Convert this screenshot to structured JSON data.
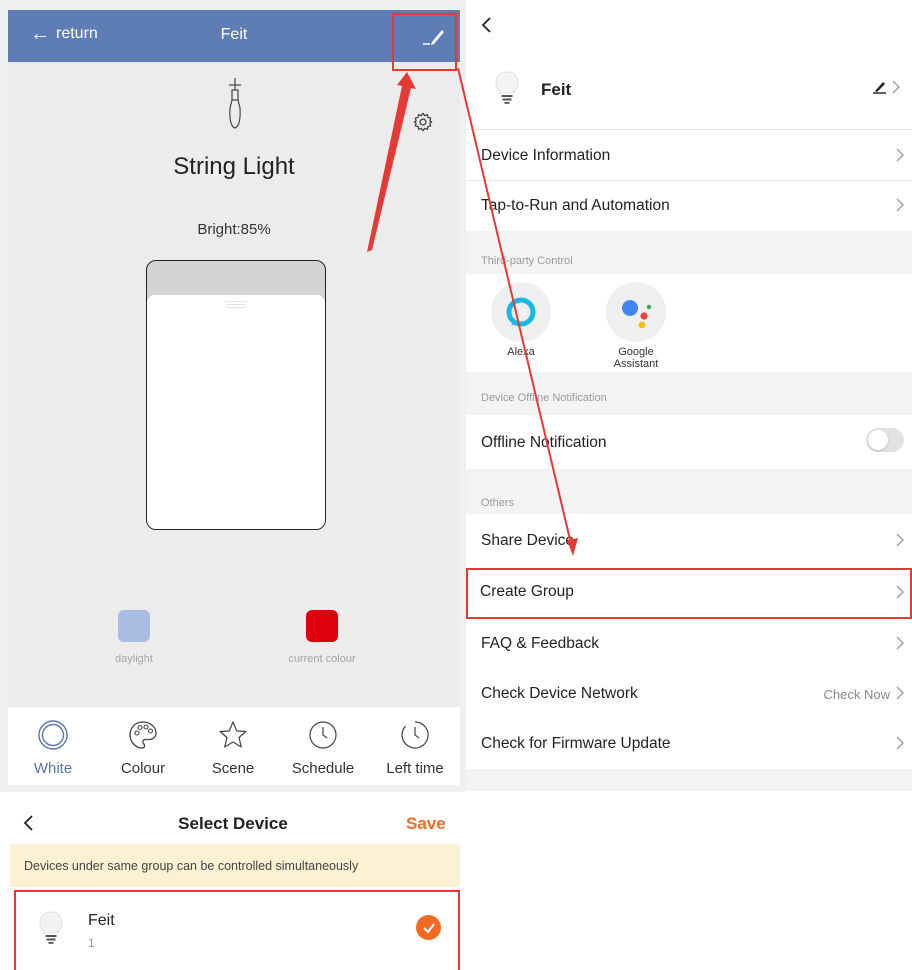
{
  "device_screen": {
    "back_label": "return",
    "title": "Feit",
    "device_name": "String Light",
    "brightness": "Bright:85%",
    "swatches": [
      {
        "label": "daylight",
        "color": "#a9bde3"
      },
      {
        "label": "current colour",
        "color": "#e0000c"
      }
    ],
    "tabs": [
      {
        "label": "White",
        "icon": "circle-icon"
      },
      {
        "label": "Colour",
        "icon": "palette-icon"
      },
      {
        "label": "Scene",
        "icon": "star-icon"
      },
      {
        "label": "Schedule",
        "icon": "clock-icon"
      },
      {
        "label": "Left time",
        "icon": "timer-icon"
      }
    ],
    "header_color": "#5f7db5",
    "active_tab_color": "#5a76b0"
  },
  "select_device": {
    "title": "Select Device",
    "save_label": "Save",
    "notice": "Devices under same group can be controlled simultaneously",
    "devices": [
      {
        "name": "Feit",
        "count": "1",
        "selected": true
      }
    ],
    "accent_color": "#f26a21"
  },
  "settings": {
    "device_name": "Feit",
    "rows_top": [
      {
        "label": "Device Information"
      },
      {
        "label": "Tap-to-Run and Automation"
      }
    ],
    "third_party_section": "Third-party Control",
    "third_party": [
      {
        "label": "Alexa",
        "icon": "alexa-icon"
      },
      {
        "label_line1": "Google",
        "label_line2": "Assistant",
        "icon": "google-assistant-icon"
      }
    ],
    "offline_section": "Device Offline Notification",
    "offline_label": "Offline Notification",
    "offline_enabled": false,
    "others_section": "Others",
    "rows_others": [
      {
        "label": "Share Device"
      },
      {
        "label": "Create Group"
      },
      {
        "label": "FAQ & Feedback"
      },
      {
        "label": "Check Device Network",
        "value": "Check Now"
      },
      {
        "label": "Check for Firmware Update"
      }
    ]
  },
  "annotation_color": "#e53935"
}
